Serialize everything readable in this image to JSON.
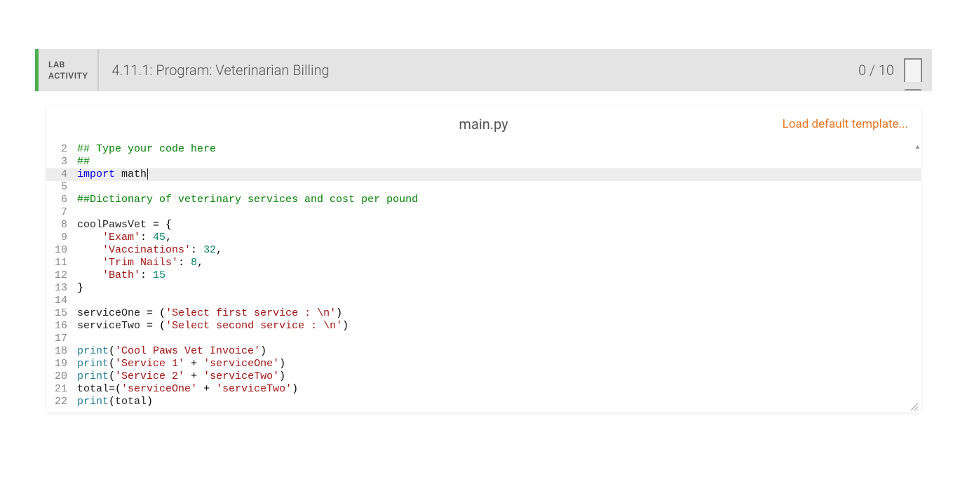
{
  "header": {
    "type_line1": "LAB",
    "type_line2": "ACTIVITY",
    "title": "4.11.1: Program: Veterinarian Billing",
    "score": "0 / 10"
  },
  "editor": {
    "filename": "main.py",
    "load_default_label": "Load default template...",
    "highlight_line": 4,
    "lines": [
      {
        "n": 2,
        "tokens": [
          {
            "t": "## Type your code here",
            "c": "comment"
          }
        ]
      },
      {
        "n": 3,
        "tokens": [
          {
            "t": "##",
            "c": "comment"
          }
        ]
      },
      {
        "n": 4,
        "tokens": [
          {
            "t": "import",
            "c": "keyword"
          },
          {
            "t": " ",
            "c": "plain"
          },
          {
            "t": "math",
            "c": "ident"
          }
        ],
        "cursor": true
      },
      {
        "n": 5,
        "tokens": []
      },
      {
        "n": 6,
        "tokens": [
          {
            "t": "##Dictionary of veterinary services and cost per pound",
            "c": "comment"
          }
        ]
      },
      {
        "n": 7,
        "tokens": []
      },
      {
        "n": 8,
        "tokens": [
          {
            "t": "coolPawsVet ",
            "c": "ident"
          },
          {
            "t": "=",
            "c": "plain"
          },
          {
            "t": " {",
            "c": "plain"
          }
        ]
      },
      {
        "n": 9,
        "tokens": [
          {
            "t": "    ",
            "c": "plain"
          },
          {
            "t": "'Exam'",
            "c": "string"
          },
          {
            "t": ": ",
            "c": "plain"
          },
          {
            "t": "45",
            "c": "num"
          },
          {
            "t": ",",
            "c": "plain"
          }
        ]
      },
      {
        "n": 10,
        "tokens": [
          {
            "t": "    ",
            "c": "plain"
          },
          {
            "t": "'Vaccinations'",
            "c": "string"
          },
          {
            "t": ": ",
            "c": "plain"
          },
          {
            "t": "32",
            "c": "num"
          },
          {
            "t": ",",
            "c": "plain"
          }
        ]
      },
      {
        "n": 11,
        "tokens": [
          {
            "t": "    ",
            "c": "plain"
          },
          {
            "t": "'Trim Nails'",
            "c": "string"
          },
          {
            "t": ": ",
            "c": "plain"
          },
          {
            "t": "8",
            "c": "num"
          },
          {
            "t": ",",
            "c": "plain"
          }
        ]
      },
      {
        "n": 12,
        "tokens": [
          {
            "t": "    ",
            "c": "plain"
          },
          {
            "t": "'Bath'",
            "c": "string"
          },
          {
            "t": ": ",
            "c": "plain"
          },
          {
            "t": "15",
            "c": "num"
          }
        ]
      },
      {
        "n": 13,
        "tokens": [
          {
            "t": "}",
            "c": "plain"
          }
        ]
      },
      {
        "n": 14,
        "tokens": []
      },
      {
        "n": 15,
        "tokens": [
          {
            "t": "serviceOne ",
            "c": "ident"
          },
          {
            "t": "=",
            "c": "plain"
          },
          {
            "t": " (",
            "c": "plain"
          },
          {
            "t": "'Select first service : \\n'",
            "c": "string"
          },
          {
            "t": ")",
            "c": "plain"
          }
        ]
      },
      {
        "n": 16,
        "tokens": [
          {
            "t": "serviceTwo ",
            "c": "ident"
          },
          {
            "t": "=",
            "c": "plain"
          },
          {
            "t": " (",
            "c": "plain"
          },
          {
            "t": "'Select second service : \\n'",
            "c": "string"
          },
          {
            "t": ")",
            "c": "plain"
          }
        ]
      },
      {
        "n": 17,
        "tokens": []
      },
      {
        "n": 18,
        "tokens": [
          {
            "t": "print",
            "c": "builtin"
          },
          {
            "t": "(",
            "c": "plain"
          },
          {
            "t": "'Cool Paws Vet Invoice'",
            "c": "string"
          },
          {
            "t": ")",
            "c": "plain"
          }
        ]
      },
      {
        "n": 19,
        "tokens": [
          {
            "t": "print",
            "c": "builtin"
          },
          {
            "t": "(",
            "c": "plain"
          },
          {
            "t": "'Service 1'",
            "c": "string"
          },
          {
            "t": " + ",
            "c": "plain"
          },
          {
            "t": "'serviceOne'",
            "c": "string"
          },
          {
            "t": ")",
            "c": "plain"
          }
        ]
      },
      {
        "n": 20,
        "tokens": [
          {
            "t": "print",
            "c": "builtin"
          },
          {
            "t": "(",
            "c": "plain"
          },
          {
            "t": "'Service 2'",
            "c": "string"
          },
          {
            "t": " + ",
            "c": "plain"
          },
          {
            "t": "'serviceTwo'",
            "c": "string"
          },
          {
            "t": ")",
            "c": "plain"
          }
        ]
      },
      {
        "n": 21,
        "tokens": [
          {
            "t": "total",
            "c": "ident"
          },
          {
            "t": "=",
            "c": "plain"
          },
          {
            "t": "(",
            "c": "plain"
          },
          {
            "t": "'serviceOne'",
            "c": "string"
          },
          {
            "t": " + ",
            "c": "plain"
          },
          {
            "t": "'serviceTwo'",
            "c": "string"
          },
          {
            "t": ")",
            "c": "plain"
          }
        ]
      },
      {
        "n": 22,
        "tokens": [
          {
            "t": "print",
            "c": "builtin"
          },
          {
            "t": "(",
            "c": "plain"
          },
          {
            "t": "total",
            "c": "ident"
          },
          {
            "t": ")",
            "c": "plain"
          }
        ]
      }
    ]
  }
}
